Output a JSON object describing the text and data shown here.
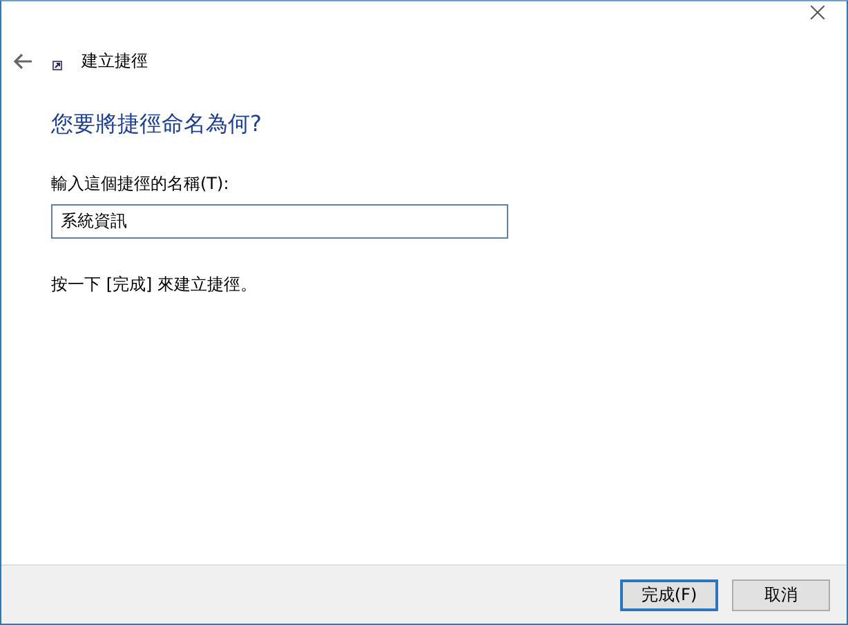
{
  "window": {
    "title": "建立捷徑"
  },
  "heading": "您要將捷徑命名為何?",
  "name_field": {
    "label": "輸入這個捷徑的名稱(T):",
    "value": "系統資訊"
  },
  "instruction": "按一下 [完成] 來建立捷徑。",
  "buttons": [
    {
      "label": "完成(F)",
      "default": true
    },
    {
      "label": "取消",
      "default": false
    }
  ]
}
